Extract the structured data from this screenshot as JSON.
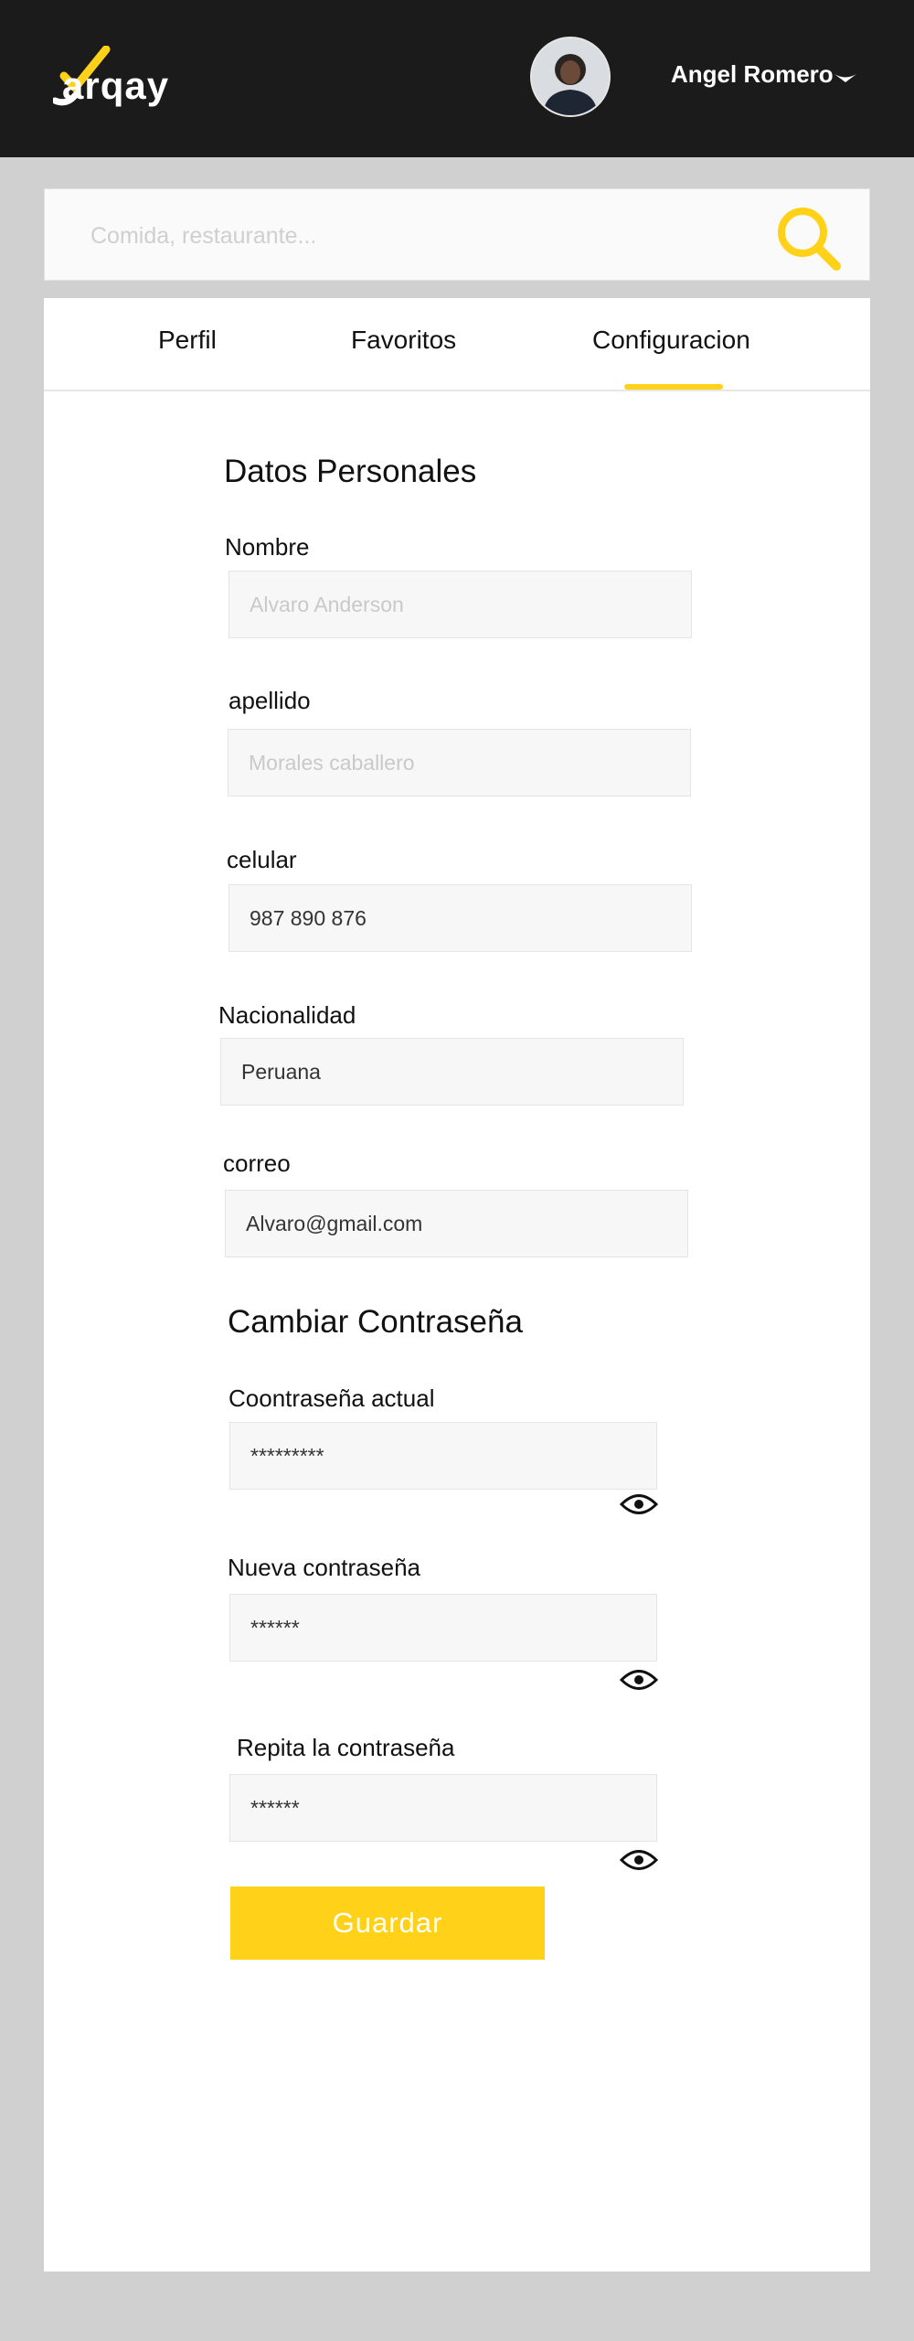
{
  "brand": {
    "name": "arqay",
    "accent": "#ffd119"
  },
  "header": {
    "user_name": "Angel Romero",
    "avatar": "user-avatar-photo"
  },
  "search": {
    "placeholder": "Comida, restaurante..."
  },
  "tabs": [
    {
      "label": "Perfil",
      "active": false
    },
    {
      "label": "Favoritos",
      "active": false
    },
    {
      "label": "Configuracion",
      "active": true
    }
  ],
  "personal": {
    "title": "Datos Personales",
    "nombre": {
      "label": "Nombre",
      "placeholder": "Alvaro Anderson"
    },
    "apellido": {
      "label": "apellido",
      "placeholder": "Morales caballero"
    },
    "celular": {
      "label": "celular",
      "value": "987 890 876"
    },
    "nacionalidad": {
      "label": "Nacionalidad",
      "value": "Peruana"
    },
    "correo": {
      "label": "correo",
      "value": "Alvaro@gmail.com"
    }
  },
  "password": {
    "title": "Cambiar Contraseña",
    "actual": {
      "label": "Coontraseña actual",
      "value": "*********"
    },
    "nueva": {
      "label": "Nueva contraseña",
      "value": "******"
    },
    "repita": {
      "label": "Repita la contraseña",
      "value": "******"
    }
  },
  "actions": {
    "save_label": "Guardar"
  }
}
